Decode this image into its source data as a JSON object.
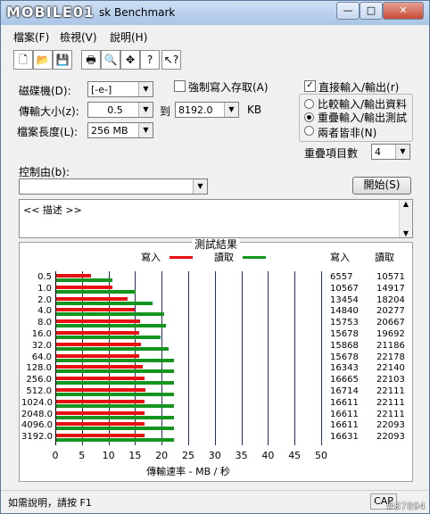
{
  "window": {
    "logo": "MOBILE01",
    "title": "sk Benchmark"
  },
  "menu": [
    {
      "label": "檔案(F)"
    },
    {
      "label": "檢視(V)"
    },
    {
      "label": "說明(H)"
    }
  ],
  "settings": {
    "drive_label": "磁碟機(D):",
    "drive_value": "[-e-]",
    "transfer_label": "傳輸大小(z):",
    "transfer_from": "0.5",
    "to_label": "到",
    "transfer_to": "8192.0",
    "unit": "KB",
    "file_length_label": "檔案長度(L):",
    "file_length": "256 MB",
    "force_write_label": "強制寫入存取(A)",
    "direct_io_label": "直接輸入/輸出(r)",
    "compare_label": "比較輸入/輸出資料",
    "overlap_label": "重疊輸入/輸出測試",
    "neither_label": "兩者皆非(N)",
    "queue_label": "重疊項目數",
    "queue_value": "4",
    "control_label": "控制由(b):",
    "control_value": "",
    "start_button": "開始(S)",
    "description": "<<   描述   >>"
  },
  "chart_data": {
    "type": "bar",
    "title": "測試結果",
    "xlabel": "傳輸速率 - MB / 秒",
    "xlim": [
      0,
      50
    ],
    "xticks": [
      0,
      5,
      10,
      15,
      20,
      25,
      30,
      35,
      40,
      45,
      50
    ],
    "legend_placement": "top",
    "categories": [
      "0.5",
      "1.0",
      "2.0",
      "4.0",
      "8.0",
      "16.0",
      "32.0",
      "64.0",
      "128.0",
      "256.0",
      "512.0",
      "1024.0",
      "2048.0",
      "4096.0",
      "3192.0"
    ],
    "series": [
      {
        "name": "寫入",
        "color": "#e81010",
        "values": [
          6557,
          10567,
          13454,
          14840,
          15753,
          15678,
          15868,
          15678,
          16343,
          16665,
          16714,
          16611,
          16611,
          16611,
          16631
        ]
      },
      {
        "name": "讀取",
        "color": "#13951e",
        "values": [
          10571,
          14917,
          18204,
          20277,
          20667,
          19692,
          21186,
          22178,
          22140,
          22103,
          22111,
          22111,
          22111,
          22093,
          22093
        ]
      }
    ],
    "column_headers": {
      "write": "寫入",
      "read": "讀取"
    }
  },
  "status": {
    "help": "如需說明，請按 F1",
    "cap": "CAP",
    "watermark": "#87894"
  }
}
